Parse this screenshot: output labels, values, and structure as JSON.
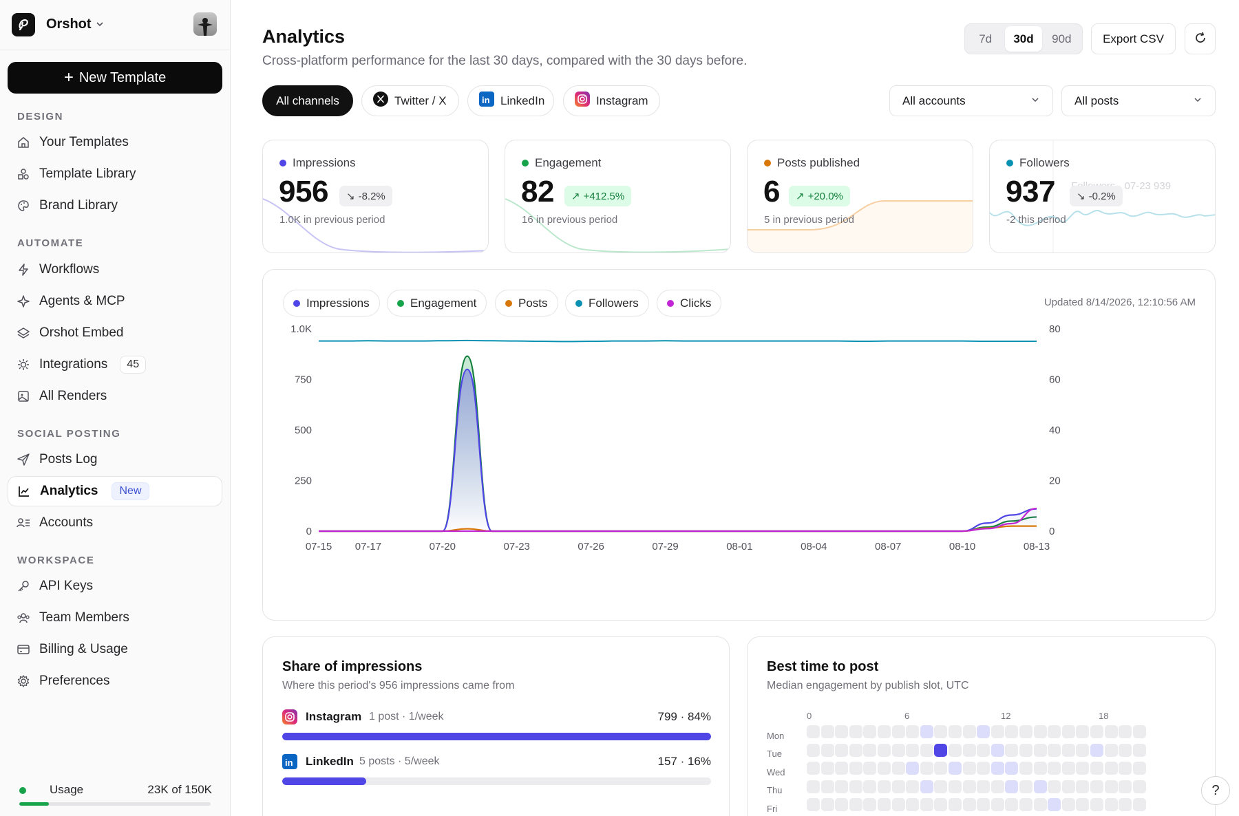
{
  "sidebar": {
    "brand": "Orshot",
    "new_template": "New Template",
    "sections": [
      {
        "label": "DESIGN",
        "items": [
          {
            "label": "Your Templates",
            "icon": "home-icon"
          },
          {
            "label": "Template Library",
            "icon": "shapes-icon"
          },
          {
            "label": "Brand Library",
            "icon": "palette-icon"
          }
        ]
      },
      {
        "label": "AUTOMATE",
        "items": [
          {
            "label": "Workflows",
            "icon": "bolt-icon"
          },
          {
            "label": "Agents & MCP",
            "icon": "sparkle-icon"
          },
          {
            "label": "Orshot Embed",
            "icon": "layers-icon"
          },
          {
            "label": "Integrations",
            "icon": "plug-icon",
            "badge": "45"
          },
          {
            "label": "All Renders",
            "icon": "image-icon"
          }
        ]
      },
      {
        "label": "SOCIAL POSTING",
        "items": [
          {
            "label": "Posts Log",
            "icon": "send-icon"
          },
          {
            "label": "Analytics",
            "icon": "chart-line-icon",
            "badge": "New",
            "active": true
          },
          {
            "label": "Accounts",
            "icon": "users-list-icon"
          }
        ]
      },
      {
        "label": "WORKSPACE",
        "items": [
          {
            "label": "API Keys",
            "icon": "key-icon"
          },
          {
            "label": "Team Members",
            "icon": "team-icon"
          },
          {
            "label": "Billing & Usage",
            "icon": "card-icon"
          },
          {
            "label": "Preferences",
            "icon": "gear-icon"
          }
        ]
      }
    ],
    "usage": {
      "label": "Usage",
      "value": "23K of 150K",
      "fraction": 0.153
    }
  },
  "header": {
    "title": "Analytics",
    "subtitle": "Cross-platform performance for the last 30 days, compared with the 30 days before.",
    "ranges": [
      "7d",
      "30d",
      "90d"
    ],
    "selected_range": "30d",
    "export_label": "Export CSV"
  },
  "channels": [
    {
      "label": "All channels",
      "selected": true,
      "icon": ""
    },
    {
      "label": "Twitter / X",
      "icon": "x-logo-icon"
    },
    {
      "label": "LinkedIn",
      "icon": "linkedin-icon"
    },
    {
      "label": "Instagram",
      "icon": "instagram-icon"
    }
  ],
  "filters": {
    "accounts": "All accounts",
    "posts": "All posts"
  },
  "kpis": [
    {
      "label": "Impressions",
      "value": "956",
      "delta": "-8.2%",
      "direction": "down",
      "prev": "1.0K in previous period",
      "color": "#4f46e5"
    },
    {
      "label": "Engagement",
      "value": "82",
      "delta": "+412.5%",
      "direction": "up",
      "prev": "16 in previous period",
      "color": "#16a34a"
    },
    {
      "label": "Posts published",
      "value": "6",
      "delta": "+20.0%",
      "direction": "up",
      "prev": "5 in previous period",
      "color": "#d97706"
    },
    {
      "label": "Followers",
      "value": "937",
      "delta": "-0.2%",
      "direction": "down",
      "prev": "-2 this period",
      "color": "#0891b2",
      "tooltip": "Followers · 07-23 939"
    }
  ],
  "main_chart": {
    "updated": "Updated 8/14/2026, 12:10:56 AM",
    "legend": [
      {
        "name": "Impressions",
        "color": "#4f46e5"
      },
      {
        "name": "Engagement",
        "color": "#16a34a"
      },
      {
        "name": "Posts",
        "color": "#d97706"
      },
      {
        "name": "Followers",
        "color": "#0891b2"
      },
      {
        "name": "Clicks",
        "color": "#c026d3"
      }
    ]
  },
  "chart_data": {
    "type": "area",
    "x": [
      "07-15",
      "07-16",
      "07-17",
      "07-18",
      "07-19",
      "07-20",
      "07-21",
      "07-22",
      "07-23",
      "07-24",
      "07-25",
      "07-26",
      "07-27",
      "07-28",
      "07-29",
      "07-30",
      "07-31",
      "08-01",
      "08-02",
      "08-03",
      "08-04",
      "08-05",
      "08-06",
      "08-07",
      "08-08",
      "08-09",
      "08-10",
      "08-11",
      "08-12",
      "08-13"
    ],
    "x_ticks": [
      "07-15",
      "07-17",
      "07-20",
      "07-23",
      "07-26",
      "07-29",
      "08-01",
      "08-04",
      "08-07",
      "08-10",
      "08-13"
    ],
    "y_left": {
      "ticks": [
        "0",
        "250",
        "500",
        "750",
        "1.0K"
      ],
      "range": [
        0,
        1000
      ]
    },
    "y_right": {
      "ticks": [
        "0",
        "20",
        "40",
        "60",
        "80"
      ],
      "range": [
        0,
        80
      ]
    },
    "series": [
      {
        "name": "Impressions",
        "axis": "left",
        "values": [
          0,
          0,
          0,
          0,
          0,
          0,
          800,
          0,
          0,
          0,
          0,
          0,
          0,
          0,
          0,
          0,
          0,
          0,
          0,
          0,
          0,
          0,
          0,
          0,
          0,
          0,
          0,
          40,
          80,
          110
        ]
      },
      {
        "name": "Engagement",
        "axis": "left",
        "values": [
          0,
          0,
          0,
          0,
          0,
          0,
          865,
          0,
          0,
          0,
          0,
          0,
          0,
          0,
          0,
          0,
          0,
          0,
          0,
          0,
          0,
          0,
          0,
          0,
          0,
          0,
          0,
          20,
          50,
          70
        ]
      },
      {
        "name": "Posts",
        "axis": "left",
        "values": [
          0,
          0,
          0,
          0,
          0,
          0,
          12,
          0,
          0,
          0,
          0,
          0,
          0,
          0,
          0,
          0,
          0,
          0,
          0,
          0,
          0,
          0,
          0,
          0,
          0,
          0,
          0,
          15,
          25,
          25
        ]
      },
      {
        "name": "Followers",
        "axis": "right",
        "values": [
          75.2,
          75.2,
          75.3,
          75.2,
          75.2,
          75.3,
          75.4,
          75.3,
          75.2,
          75.1,
          75.0,
          75.1,
          75.2,
          75.2,
          75.3,
          75.2,
          75.2,
          75.2,
          75.2,
          75.2,
          75.2,
          75.2,
          75.1,
          75.2,
          75.2,
          75.2,
          75.2,
          75.1,
          75.1,
          75.1
        ]
      },
      {
        "name": "Clicks",
        "axis": "right",
        "values": [
          0,
          0,
          0,
          0,
          0,
          0,
          0,
          0,
          0,
          0,
          0,
          0,
          0,
          0,
          0,
          0,
          0,
          0,
          0,
          0,
          0,
          0,
          0,
          0,
          0,
          0,
          0,
          1,
          3,
          9
        ]
      }
    ]
  },
  "share": {
    "title": "Share of impressions",
    "subtitle": "Where this period's 956 impressions came from",
    "rows": [
      {
        "name": "Instagram",
        "meta": "1 post · 1/week",
        "value": "799 · 84%",
        "fraction": 1.0,
        "icon": "instagram-icon"
      },
      {
        "name": "LinkedIn",
        "meta": "5 posts · 5/week",
        "value": "157 · 16%",
        "fraction": 0.196,
        "icon": "linkedin-icon"
      }
    ]
  },
  "best_time": {
    "title": "Best time to post",
    "subtitle": "Median engagement by publish slot, UTC",
    "hour_labels": [
      "0",
      "6",
      "12",
      "18"
    ],
    "days": [
      "Mon",
      "Tue",
      "Wed",
      "Thu",
      "Fri"
    ],
    "highlights": [
      {
        "day": 0,
        "hour": 8,
        "level": 1
      },
      {
        "day": 0,
        "hour": 12,
        "level": 1
      },
      {
        "day": 1,
        "hour": 9,
        "level": 3
      },
      {
        "day": 1,
        "hour": 13,
        "level": 1
      },
      {
        "day": 1,
        "hour": 20,
        "level": 1
      },
      {
        "day": 2,
        "hour": 7,
        "level": 1
      },
      {
        "day": 2,
        "hour": 10,
        "level": 1
      },
      {
        "day": 2,
        "hour": 13,
        "level": 1
      },
      {
        "day": 2,
        "hour": 14,
        "level": 1
      },
      {
        "day": 3,
        "hour": 8,
        "level": 1
      },
      {
        "day": 3,
        "hour": 14,
        "level": 1
      },
      {
        "day": 3,
        "hour": 16,
        "level": 1
      },
      {
        "day": 4,
        "hour": 17,
        "level": 1
      }
    ]
  },
  "help_label": "?"
}
